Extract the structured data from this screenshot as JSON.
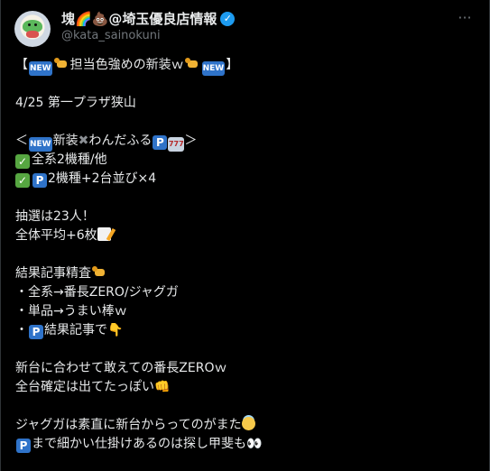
{
  "header": {
    "display_name": "塊🌈💩@埼玉優良店情報",
    "handle": "@kata_sainokuni",
    "more_label": "···"
  },
  "post": {
    "l1_open": "【",
    "l1_text": "担当色強めの新装ｗ",
    "l1_close": "】",
    "l2": "4/25 第一プラザ狭山",
    "l3_open": "＜",
    "l3_a": "新装",
    "l3_b": "わんだふる",
    "l3_close": "＞",
    "l4": "全系2機種/他",
    "l5": "2機種+2台並び×4",
    "l6": "抽選は23人！",
    "l7": "全体平均+6枚",
    "l8": "結果記事精査",
    "l9": "・全系→番長ZERO/ジャグガ",
    "l10": "・単品→うまい棒ｗ",
    "l11_pre": "・",
    "l11_text": "結果記事で",
    "l12": "新台に合わせて敢えての番長ZEROｗ",
    "l13": "全台確定は出てたっぽい",
    "l14": "ジャグガは素直に新台からってのがまた",
    "l15": "まで細かい仕掛けあるのは探し甲斐も"
  },
  "badges": {
    "new": "NEW",
    "parking": "P",
    "slot": "777"
  },
  "icons": {
    "verified": "verified-badge-icon",
    "check": "check-mark-icon",
    "cross": "cross-mark-icon",
    "cat": "cat-icon",
    "memo": "memo-icon",
    "point_down": "point-down-icon",
    "punch": "punch-icon",
    "halo": "smiling-halo-icon",
    "eyes": "eyes-icon"
  },
  "colors": {
    "background": "#000000",
    "text": "#e7e9ea",
    "secondary": "#71767b",
    "badge_blue": "#2f73c9",
    "check_green": "#56a641",
    "verified_blue": "#1d9bf0"
  }
}
